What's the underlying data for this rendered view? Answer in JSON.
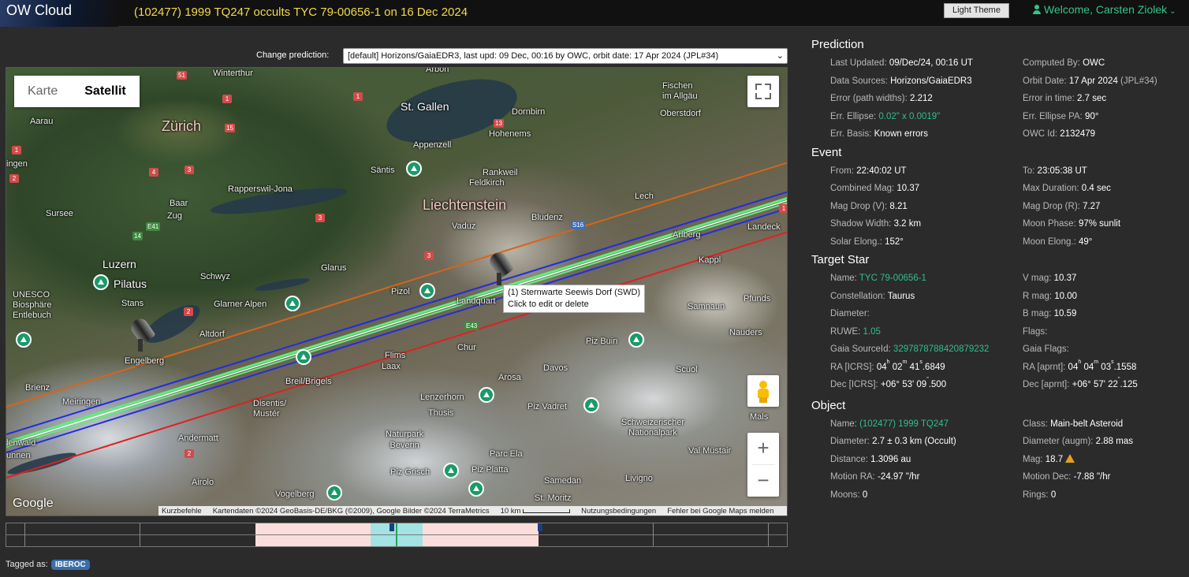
{
  "app": {
    "logo": "OW Cloud",
    "title": "(102477) 1999 TQ247 occults TYC 79-00656-1 on 16 Dec 2024"
  },
  "header": {
    "theme_button": "Light Theme",
    "welcome": "Welcome, Carsten Ziolek"
  },
  "prediction_selector": {
    "label": "Change prediction:",
    "selected": "[default] Horizons/GaiaEDR3, last upd: 09 Dec, 00:16 by OWC, orbit date: 17 Apr 2024 (JPL#34)"
  },
  "map": {
    "type_buttons": [
      "Karte",
      "Satellit"
    ],
    "active_type": "Satellit",
    "tooltip_line1": "(1) Sternwarte Seewis Dorf (SWD)",
    "tooltip_line2": "Click to edit or delete",
    "zoom_in": "+",
    "zoom_out": "−",
    "google_logo": "Google",
    "attribution": [
      "Kurzbefehle",
      "Kartendaten ©2024 GeoBasis-DE/BKG (©2009), Google Bilder ©2024 TerraMetrics",
      "10 km",
      "Nutzungsbedingungen",
      "Fehler bei Google Maps melden"
    ],
    "places": {
      "zurich": "Zürich",
      "liechtenstein": "Liechtenstein",
      "st_gallen": "St. Gallen",
      "winterthur": "Winterthur",
      "luzern": "Luzern",
      "pilatus": "Pilatus",
      "vaduz": "Vaduz",
      "chur": "Chur",
      "davos": "Davos",
      "appenzell": "Appenzell",
      "feldkirch": "Feldkirch",
      "bludenz": "Bludenz",
      "rapperswil": "Rapperswil-Jona",
      "schwyz": "Schwyz",
      "glarus": "Glarus",
      "unesco": "UNESCO\nBiosphäre\nEntlebuch",
      "engelberg": "Engelberg",
      "altdorf": "Altdorf",
      "glarner_alpen": "Glarner Alpen",
      "saentis": "Säntis",
      "pizol": "Pizol",
      "landquart": "Landquart",
      "brienz": "Brienz",
      "meiringen": "Meiringen",
      "disentis": "Disentis/\nMustér",
      "breil": "Breil/Brigels",
      "flims": "Flims",
      "laax": "Laax",
      "lenzerhorn": "Lenzerhorn",
      "thusis": "Thusis",
      "arosa": "Arosa",
      "piz_vadret": "Piz Vadret",
      "piz_buin": "Piz Buin",
      "scuol": "Scuol",
      "naturpark": "Naturpark\nBeverin",
      "parc_ela": "Parc Ela",
      "piz_grisch": "Piz Grisch",
      "piz_platta": "Piz Platta",
      "samedan": "Samedan",
      "st_moritz": "St. Moritz",
      "livigno": "Livigno",
      "val_muestair": "Val Müstair",
      "nationalpark": "Schweizerischer\nNationalpark",
      "andermatt": "Andermatt",
      "airolo": "Airolo",
      "vogelberg": "Vogelberg",
      "stans": "Stans",
      "sursee": "Sursee",
      "aarau": "Aarau",
      "baar": "Baar",
      "zug": "Zug",
      "arbon": "Arbon",
      "fischen": "Fischen\nim Allgäu",
      "oberstdorf": "Oberstdorf",
      "dornbirn": "Dornbirn",
      "hohenems": "Hohenems",
      "rankweil": "Rankweil",
      "lech": "Lech",
      "landeck": "Landeck",
      "kappl": "Kappl",
      "pfunds": "Pfunds",
      "nauders": "Nauders",
      "samnaun": "Samnaun",
      "mals": "Mals",
      "arlberg": "Arlberg",
      "ingen": "ingen",
      "unnen": "unnen",
      "lenwald": "lenwald"
    }
  },
  "timeline": {
    "tagged_label": "Tagged as:",
    "tag": "IBEROC"
  },
  "colors": {
    "accent": "#2fbf8a",
    "title": "#f1d94b",
    "path_orange": "#d8641a",
    "path_blue": "#1f2de0",
    "path_green": "#5cf07a",
    "path_red": "#e02020"
  },
  "prediction": {
    "title": "Prediction",
    "left": [
      {
        "k": "Last Updated:",
        "v": "09/Dec/24, 00:16 UT"
      },
      {
        "k": "Data Sources:",
        "v": "Horizons/GaiaEDR3"
      },
      {
        "k": "Error (path widths):",
        "v": "2.212"
      },
      {
        "k": "Err. Ellipse:",
        "v": "0.02\" x 0.0019\""
      },
      {
        "k": "Err. Basis:",
        "v": "Known errors"
      }
    ],
    "right": [
      {
        "k": "Computed By:",
        "v": "OWC"
      },
      {
        "k": "Orbit Date:",
        "v": "17 Apr 2024",
        "v2": "(JPL#34)"
      },
      {
        "k": "Error in time:",
        "v": "2.7 sec"
      },
      {
        "k": "Err. Ellipse PA:",
        "v": "90°"
      },
      {
        "k": "OWC Id:",
        "v": "2132479"
      }
    ]
  },
  "event": {
    "title": "Event",
    "left": [
      {
        "k": "From:",
        "v": "22:40:02 UT"
      },
      {
        "k": "Combined Mag:",
        "v": "10.37"
      },
      {
        "k": "Mag Drop (V):",
        "v": "8.21"
      },
      {
        "k": "Shadow Width:",
        "v": "3.2 km"
      },
      {
        "k": "Solar Elong.:",
        "v": "152°"
      }
    ],
    "right": [
      {
        "k": "To:",
        "v": "23:05:38 UT"
      },
      {
        "k": "Max Duration:",
        "v": "0.4 sec"
      },
      {
        "k": "Mag Drop (R):",
        "v": "7.27"
      },
      {
        "k": "Moon Phase:",
        "v": "97% sunlit"
      },
      {
        "k": "Moon Elong.:",
        "v": "49°"
      }
    ]
  },
  "target_star": {
    "title": "Target Star",
    "name_k": "Name:",
    "name_v": "TYC 79-00656-1",
    "constellation_k": "Constellation:",
    "constellation_v": "Taurus",
    "diameter_k": "Diameter:",
    "ruwe_k": "RUWE:",
    "ruwe_v": "1.05",
    "gaia_k": "Gaia SourceId:",
    "gaia_v": "3297878788420879232",
    "ra_k": "RA [ICRS]:",
    "ra_h": "04",
    "ra_m": "02",
    "ra_s": "41",
    "ra_f": ".6849",
    "dec_k": "Dec [ICRS]:",
    "dec_d": "+06° 53",
    "dec_m": "09",
    "dec_f": ".500",
    "vmag_k": "V mag:",
    "vmag_v": "10.37",
    "rmag_k": "R mag:",
    "rmag_v": "10.00",
    "bmag_k": "B mag:",
    "bmag_v": "10.59",
    "flags_k": "Flags:",
    "gaiaflags_k": "Gaia Flags:",
    "rap_k": "RA [aprnt]:",
    "rap_h": "04",
    "rap_m": "04",
    "rap_s": "03",
    "rap_f": ".1558",
    "decp_k": "Dec [aprnt]:",
    "decp_d": "+06° 57",
    "decp_m": "22",
    "decp_f": ".125"
  },
  "object": {
    "title": "Object",
    "left": [
      {
        "k": "Name:",
        "v": "(102477) 1999 TQ247"
      },
      {
        "k": "Diameter:",
        "v": "2.7 ± 0.3 km",
        "v2": "(Occult)"
      },
      {
        "k": "Distance:",
        "v": "1.3096 au"
      },
      {
        "k": "Motion RA:",
        "v": "-24.97 \"/hr"
      },
      {
        "k": "Moons:",
        "v": "0"
      }
    ],
    "right": [
      {
        "k": "Class:",
        "v": "Main-belt Asteroid"
      },
      {
        "k": "Diameter (augm):",
        "v": "2.88 mas"
      },
      {
        "k": "Mag:",
        "v": "18.7"
      },
      {
        "k": "Motion Dec:",
        "v": "-7.88 \"/hr"
      },
      {
        "k": "Rings:",
        "v": "0"
      }
    ]
  }
}
